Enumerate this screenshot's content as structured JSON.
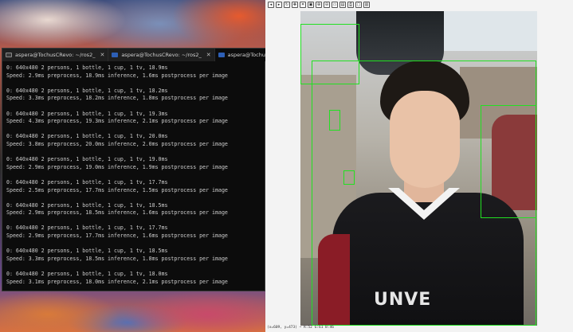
{
  "terminal": {
    "tabs": [
      {
        "label": "aspera@TochusCRevo: ~/ros2_",
        "icon": "terminal-icon",
        "active": false
      },
      {
        "label": "aspera@TochusCRevo: ~/ros2_",
        "icon": "powershell-icon",
        "active": false
      },
      {
        "label": "aspera@TochusCRevo: ~",
        "icon": "powershell-icon",
        "active": true
      }
    ],
    "new_tab": "+",
    "lines": [
      "0: 640x480 2 persons, 1 bottle, 1 cup, 1 tv, 18.9ms",
      "Speed: 2.9ms preprocess, 18.9ms inference, 1.6ms postprocess per image",
      "",
      "0: 640x480 2 persons, 1 bottle, 1 cup, 1 tv, 18.2ms",
      "Speed: 3.3ms preprocess, 18.2ms inference, 1.8ms postprocess per image",
      "",
      "0: 640x480 2 persons, 1 bottle, 1 cup, 1 tv, 19.3ms",
      "Speed: 4.3ms preprocess, 19.3ms inference, 2.1ms postprocess per image",
      "",
      "0: 640x480 2 persons, 1 bottle, 1 cup, 1 tv, 20.0ms",
      "Speed: 3.8ms preprocess, 20.0ms inference, 2.0ms postprocess per image",
      "",
      "0: 640x480 2 persons, 1 bottle, 1 cup, 1 tv, 19.0ms",
      "Speed: 2.9ms preprocess, 19.0ms inference, 1.9ms postprocess per image",
      "",
      "0: 640x480 2 persons, 1 bottle, 1 cup, 1 tv, 17.7ms",
      "Speed: 2.5ms preprocess, 17.7ms inference, 1.5ms postprocess per image",
      "",
      "0: 640x480 2 persons, 1 bottle, 1 cup, 1 tv, 18.5ms",
      "Speed: 2.9ms preprocess, 18.5ms inference, 1.6ms postprocess per image",
      "",
      "0: 640x480 2 persons, 1 bottle, 1 cup, 1 tv, 17.7ms",
      "Speed: 2.9ms preprocess, 17.7ms inference, 1.6ms postprocess per image",
      "",
      "0: 640x480 2 persons, 1 bottle, 1 cup, 1 tv, 18.5ms",
      "Speed: 3.3ms preprocess, 18.5ms inference, 1.8ms postprocess per image",
      "",
      "0: 640x480 2 persons, 1 bottle, 1 cup, 1 tv, 18.0ms",
      "Speed: 3.1ms preprocess, 18.0ms inference, 2.1ms postprocess per image"
    ]
  },
  "viewer": {
    "toolbar": [
      "◂",
      "▸",
      "↻",
      "✥",
      "⌗",
      "▣",
      "⊕",
      "⊖",
      "▭",
      "▤",
      "⎙",
      "▢",
      "▥"
    ],
    "status": "(x=609, y=473) ~ R:52 G:61 B:46",
    "overlay_text": "UNVE"
  },
  "colors": {
    "detection_box": "#22e022",
    "terminal_bg": "#0c0c0c",
    "terminal_text": "#cccccc"
  }
}
